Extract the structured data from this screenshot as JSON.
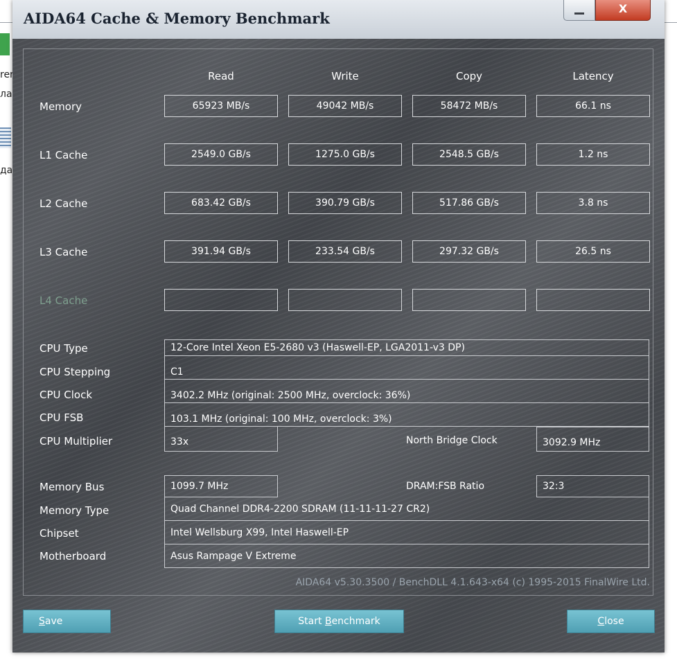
{
  "window": {
    "title": "AIDA64 Cache & Memory Benchmark",
    "close_glyph": "X"
  },
  "background_text": [
    "rer",
    "ла",
    "да"
  ],
  "columns": [
    "Read",
    "Write",
    "Copy",
    "Latency"
  ],
  "benchmarks": [
    {
      "label": "Memory",
      "values": [
        "65923 MB/s",
        "49042 MB/s",
        "58472 MB/s",
        "66.1 ns"
      ]
    },
    {
      "label": "L1 Cache",
      "values": [
        "2549.0 GB/s",
        "1275.0 GB/s",
        "2548.5 GB/s",
        "1.2 ns"
      ]
    },
    {
      "label": "L2 Cache",
      "values": [
        "683.42 GB/s",
        "390.79 GB/s",
        "517.86 GB/s",
        "3.8 ns"
      ]
    },
    {
      "label": "L3 Cache",
      "values": [
        "391.94 GB/s",
        "233.54 GB/s",
        "297.32 GB/s",
        "26.5 ns"
      ]
    },
    {
      "label": "L4 Cache",
      "values": [
        "",
        "",
        "",
        ""
      ]
    }
  ],
  "cpu": {
    "type_label": "CPU Type",
    "type_value": "12-Core Intel Xeon E5-2680 v3  (Haswell-EP, LGA2011-v3 DP)",
    "stepping_label": "CPU Stepping",
    "stepping_value": "C1",
    "clock_label": "CPU Clock",
    "clock_value": "3402.2 MHz  (original: 2500 MHz, overclock: 36%)",
    "fsb_label": "CPU FSB",
    "fsb_value": "103.1 MHz  (original: 100 MHz, overclock: 3%)",
    "multiplier_label": "CPU Multiplier",
    "multiplier_value": "33x",
    "nb_clock_label": "North Bridge Clock",
    "nb_clock_value": "3092.9 MHz"
  },
  "memory": {
    "bus_label": "Memory Bus",
    "bus_value": "1099.7 MHz",
    "ratio_label": "DRAM:FSB Ratio",
    "ratio_value": "32:3",
    "type_label": "Memory Type",
    "type_value": "Quad Channel DDR4-2200 SDRAM  (11-11-11-27 CR2)",
    "chipset_label": "Chipset",
    "chipset_value": "Intel Wellsburg X99, Intel Haswell-EP",
    "motherboard_label": "Motherboard",
    "motherboard_value": "Asus Rampage V Extreme"
  },
  "footer": "AIDA64 v5.30.3500 / BenchDLL 4.1.643-x64  (c) 1995-2015 FinalWire Ltd.",
  "buttons": {
    "save_first": "S",
    "save_rest": "ave",
    "start_pre": "Start ",
    "start_u": "B",
    "start_rest": "enchmark",
    "close_first": "C",
    "close_rest": "lose"
  },
  "colors": {
    "button": "#5aaabd",
    "close": "#c23b22",
    "dim_label": "#7fa08f"
  }
}
